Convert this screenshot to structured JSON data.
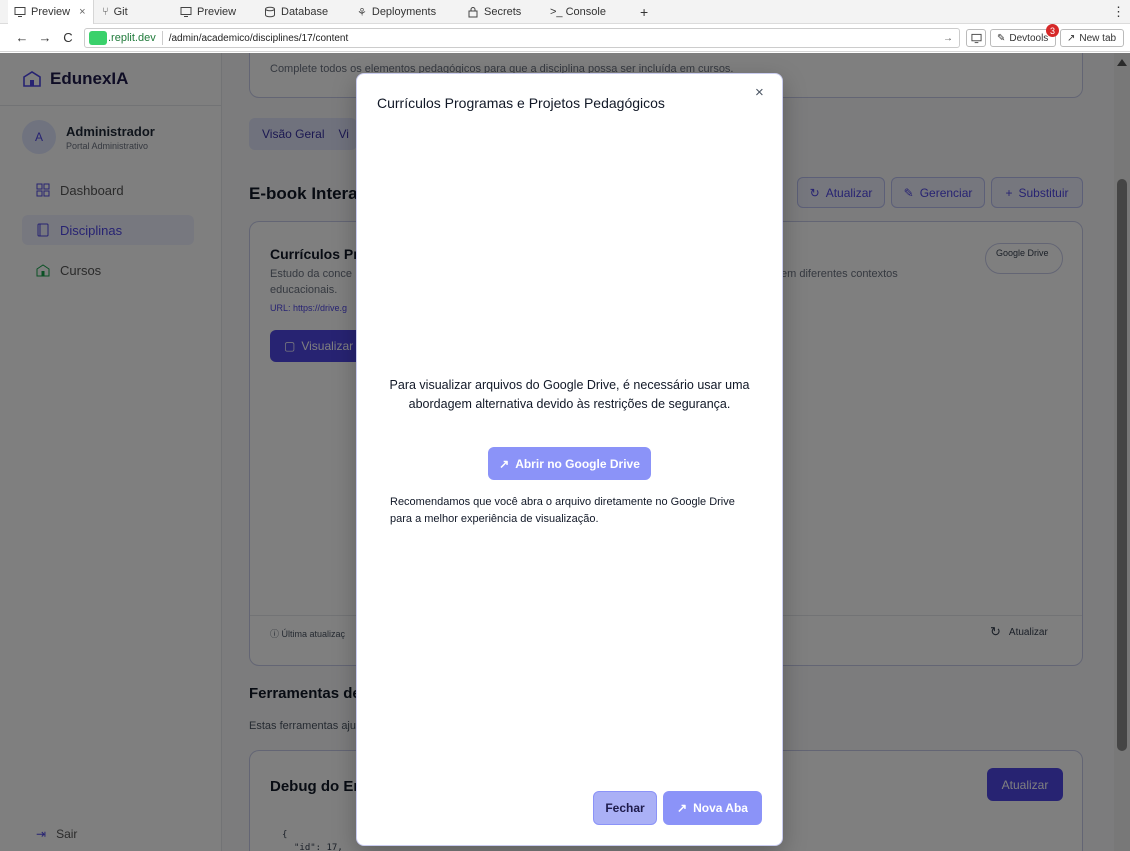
{
  "browser": {
    "tabs": [
      {
        "label": "Preview",
        "icon": "monitor-icon"
      },
      {
        "label": "Git",
        "icon": "git-icon"
      },
      {
        "label": "Preview",
        "icon": "monitor-icon"
      },
      {
        "label": "Database",
        "icon": "database-icon"
      },
      {
        "label": "Deployments",
        "icon": "deploy-icon"
      },
      {
        "label": "Secrets",
        "icon": "lock-icon"
      },
      {
        "label": ">_ Console",
        "icon": "console-icon"
      }
    ],
    "tab_close": "×",
    "new_tab": "+",
    "menu": "⋮",
    "url_domain": ".replit.dev",
    "url_path": "/admin/academico/disciplines/17/content",
    "devtools_label": "Devtools",
    "devtools_badge": "3",
    "newtab_label": "New tab"
  },
  "sidebar": {
    "brand": "EdunexIA",
    "avatar": "A",
    "user_name": "Administrador",
    "user_role": "Portal Administrativo",
    "items": [
      {
        "label": "Dashboard",
        "icon": "dashboard-icon"
      },
      {
        "label": "Disciplinas",
        "icon": "book-icon"
      },
      {
        "label": "Cursos",
        "icon": "school-icon"
      }
    ],
    "logout": "Sair"
  },
  "main": {
    "top_note": "Complete todos os elementos pedagógicos para que a disciplina possa ser incluída em cursos.",
    "tabs": [
      "Visão Geral",
      "Vi"
    ],
    "section_title": "E-book Interat",
    "actions": {
      "refresh": "Atualizar",
      "manage": "Gerenciar",
      "replace": "Substituir"
    },
    "ebook": {
      "title": "Currículos Pr",
      "desc_line1": "Estudo da conce",
      "desc_line1_right": "em diferentes contextos",
      "desc_line2": "educacionais.",
      "url": "URL: https://drive.g",
      "badge": "Google Drive",
      "view_button": "Visualizar",
      "last_update": "ⓘ Última atualizaç",
      "footer_refresh": "Atualizar"
    },
    "tools_title": "Ferramentas de",
    "tools_desc": "Estas ferramentas aju",
    "debug_title": "Debug do Er",
    "debug_refresh": "Atualizar",
    "code_line1": "{",
    "code_line2": "\"id\": 17,"
  },
  "modal": {
    "title": "Currículos Programas e Projetos Pedagógicos",
    "close": "×",
    "message": "Para visualizar arquivos do Google Drive, é necessário usar uma abordagem alternativa devido às restrições de segurança.",
    "open_button": "Abrir no Google Drive",
    "recommendation": "Recomendamos que você abra o arquivo diretamente no Google Drive para a melhor experiência de visualização.",
    "close_button": "Fechar",
    "new_tab_button": "Nova Aba"
  },
  "colors": {
    "accent": "#4f46e5",
    "modal_button": "#8b93f8",
    "overlay": "rgba(0,0,0,0.5)"
  }
}
